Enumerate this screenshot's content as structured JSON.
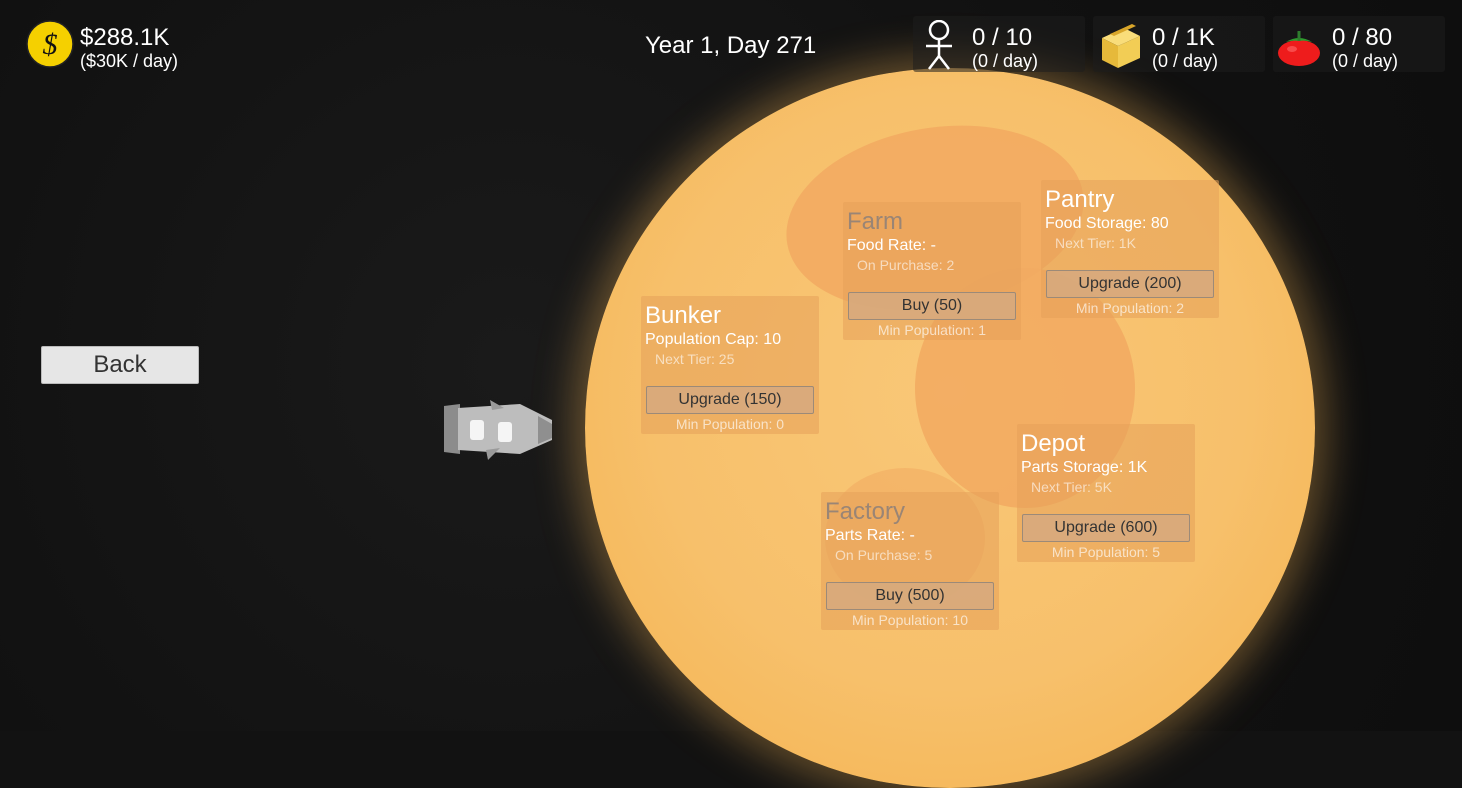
{
  "hud": {
    "money": {
      "amount": "$288.1K",
      "rate": "($30K / day)",
      "icon": "dollar-coin-icon"
    },
    "date": "Year 1, Day 271",
    "population": {
      "amount": "0 / 10",
      "rate": "(0 / day)",
      "icon": "stick-figure-icon"
    },
    "parts": {
      "amount": "0 / 1K",
      "rate": "(0 / day)",
      "icon": "crate-icon"
    },
    "food": {
      "amount": "0 / 80",
      "rate": "(0 / day)",
      "icon": "tomato-icon"
    }
  },
  "back_label": "Back",
  "buildings": {
    "bunker": {
      "title": "Bunker",
      "stat": "Population Cap: 10",
      "note": "Next Tier: 25",
      "button": "Upgrade (150)",
      "requirement": "Min Population: 0"
    },
    "farm": {
      "title": "Farm",
      "stat": "Food Rate: -",
      "note": "On Purchase: 2",
      "button": "Buy (50)",
      "requirement": "Min Population: 1"
    },
    "pantry": {
      "title": "Pantry",
      "stat": "Food Storage: 80",
      "note": "Next Tier: 1K",
      "button": "Upgrade (200)",
      "requirement": "Min Population: 2"
    },
    "depot": {
      "title": "Depot",
      "stat": "Parts Storage: 1K",
      "note": "Next Tier: 5K",
      "button": "Upgrade (600)",
      "requirement": "Min Population: 5"
    },
    "factory": {
      "title": "Factory",
      "stat": "Parts Rate: -",
      "note": "On Purchase: 5",
      "button": "Buy (500)",
      "requirement": "Min Population: 10"
    }
  },
  "colors": {
    "planet": "#f7c06b",
    "accent_coin": "#f5d000",
    "background": "#121212"
  }
}
